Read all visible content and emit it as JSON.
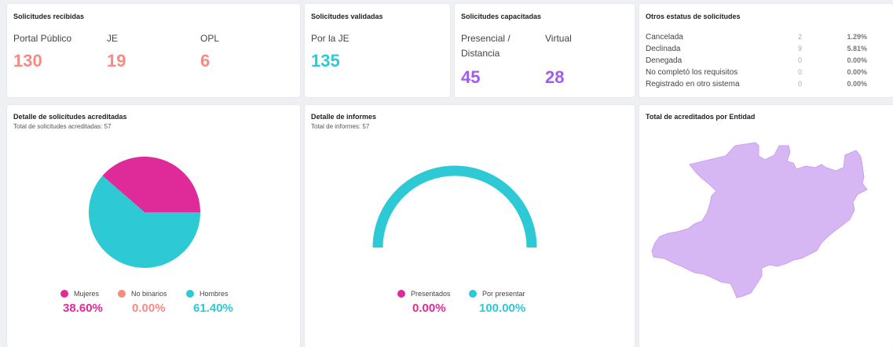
{
  "recibidas": {
    "title": "Solicitudes recibidas",
    "items": [
      {
        "label": "Portal Público",
        "value": "130"
      },
      {
        "label": "JE",
        "value": "19"
      },
      {
        "label": "OPL",
        "value": "6"
      }
    ]
  },
  "validadas": {
    "title": "Solicitudes validadas",
    "label": "Por la JE",
    "value": "135"
  },
  "capacitadas": {
    "title": "Solicitudes capacitadas",
    "items": [
      {
        "label_line1": "Presencial /",
        "label_line2": "Distancia",
        "value": "45"
      },
      {
        "label_line1": "Virtual",
        "label_line2": "",
        "value": "28"
      }
    ]
  },
  "otros": {
    "title": "Otros estatus de solicitudes",
    "rows": [
      {
        "name": "Cancelada",
        "count": "2",
        "pct": "1.29%"
      },
      {
        "name": "Declinada",
        "count": "9",
        "pct": "5.81%"
      },
      {
        "name": "Denegada",
        "count": "0",
        "pct": "0.00%"
      },
      {
        "name": "No completó los requisitos",
        "count": "0",
        "pct": "0.00%"
      },
      {
        "name": "Registrado en otro sistema",
        "count": "0",
        "pct": "0.00%"
      }
    ]
  },
  "acreditadas": {
    "title": "Detalle de solicitudes acreditadas",
    "subtitle": "Total de solicitudes acreditadas: 57",
    "legend": [
      {
        "label": "Mujeres",
        "pct": "38.60%",
        "color": "#df2a99"
      },
      {
        "label": "No binarios",
        "pct": "0.00%",
        "color": "#f58b83"
      },
      {
        "label": "Hombres",
        "pct": "61.40%",
        "color": "#2dc9d4"
      }
    ]
  },
  "informes": {
    "title": "Detalle de informes",
    "subtitle": "Total de informes: 57",
    "legend": [
      {
        "label": "Presentados",
        "pct": "0.00%",
        "color": "#df2a99"
      },
      {
        "label": "Por presentar",
        "pct": "100.00%",
        "color": "#2dc9d4"
      }
    ]
  },
  "entidad": {
    "title": "Total de acreditados por Entidad",
    "map_color": "#d6b6f3"
  },
  "chart_data": [
    {
      "type": "pie",
      "categories": [
        "Mujeres",
        "No binarios",
        "Hombres"
      ],
      "values": [
        38.6,
        0.0,
        61.4
      ],
      "colors": [
        "#df2a99",
        "#f58b83",
        "#2dc9d4"
      ],
      "title": "Detalle de solicitudes acreditadas",
      "subtitle": "Total de solicitudes acreditadas: 57",
      "legend": "bottom"
    },
    {
      "type": "pie",
      "categories": [
        "Presentados",
        "Por presentar"
      ],
      "values": [
        0.0,
        100.0
      ],
      "colors": [
        "#df2a99",
        "#2dc9d4"
      ],
      "title": "Detalle de informes",
      "subtitle": "Total de informes: 57",
      "legend": "bottom"
    }
  ]
}
